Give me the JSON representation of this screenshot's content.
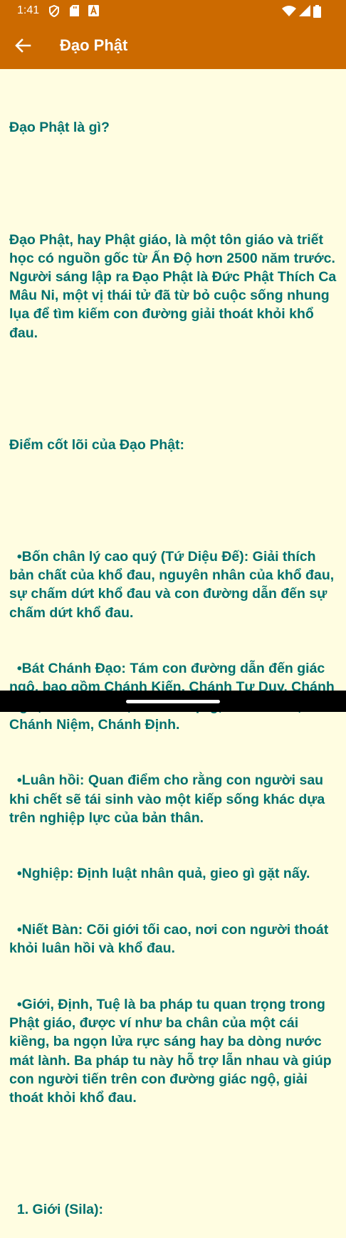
{
  "status_bar": {
    "time": "1:41",
    "icons": [
      "vpn-key-icon",
      "sd-card-icon",
      "font-a-icon",
      "wifi-icon",
      "signal-icon",
      "battery-icon"
    ]
  },
  "app_bar": {
    "title": "Đạo Phật",
    "back_icon": "arrow-back-icon"
  },
  "content": {
    "heading1": "Đạo Phật là gì?",
    "intro": "Đạo Phật, hay Phật giáo, là một tôn giáo và triết học có nguồn gốc từ Ấn Độ hơn 2500 năm trước. Người sáng lập ra Đạo Phật là Đức Phật Thích Ca Mâu Ni, một vị thái tử đã từ bỏ cuộc sống nhung lụa để tìm kiếm con đường giải thoát khỏi khổ đau.",
    "heading2": "Điểm cốt lõi của Đạo Phật:",
    "bullets": [
      "  •Bốn chân lý cao quý (Tứ Diệu Đế): Giải thích bản chất của khổ đau, nguyên nhân của khổ đau, sự chấm dứt khổ đau và con đường dẫn đến sự chấm dứt khổ đau.",
      "  •Bát Chánh Đạo: Tám con đường dẫn đến giác ngộ, bao gồm Chánh Kiến, Chánh Tư Duy, Chánh Ngữ, Chánh Hành, Chánh Mạng, Chánh Tấn, Chánh Niệm, Chánh Định.",
      "  •Luân hồi: Quan điểm cho rằng con người sau khi chết sẽ tái sinh vào một kiếp sống khác dựa trên nghiệp lực của bản thân.",
      "  •Nghiệp: Định luật nhân quả, gieo gì gặt nấy.",
      "  •Niết Bàn: Cõi giới tối cao, nơi con người thoát khỏi luân hồi và khổ đau.",
      "  •Giới, Định, Tuệ là ba pháp tu quan trọng trong Phật giáo, được ví như ba chân của một cái kiềng, ba ngọn lửa rực sáng hay ba dòng nước mát lành. Ba pháp tu này hỗ trợ lẫn nhau và giúp con người tiến trên con đường giác ngộ, giải thoát khỏi khổ đau."
    ],
    "section1": "  1. Giới (Sila):"
  },
  "colors": {
    "app_bar": "#CC6A00",
    "background": "#FFFDE1",
    "text": "#00706E"
  }
}
